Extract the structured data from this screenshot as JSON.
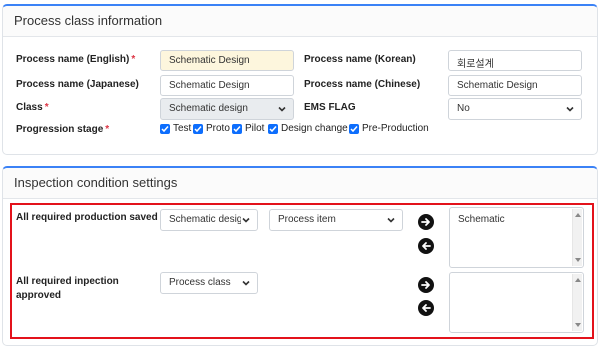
{
  "process_class": {
    "title": "Process class information",
    "labels": {
      "name_en": "Process name (English)",
      "name_ko": "Process name (Korean)",
      "name_ja": "Process name (Japanese)",
      "name_zh": "Process name (Chinese)",
      "class": "Class",
      "ems_flag": "EMS FLAG",
      "stage": "Progression stage",
      "required_mark": "*"
    },
    "values": {
      "name_en": "Schematic Design",
      "name_ko": "회로설계",
      "name_ja": "Schematic Design",
      "name_zh": "Schematic Design",
      "class": "Schematic design",
      "ems_flag": "No"
    },
    "stages": [
      "Test",
      "Proto",
      "Pilot",
      "Design change",
      "Pre-Production"
    ]
  },
  "inspection": {
    "title": "Inspection condition settings",
    "row1": {
      "label": "All required production saved",
      "select1": "Schematic design",
      "select2": "Process item",
      "list_items": [
        "Schematic"
      ]
    },
    "row2": {
      "label_line1": "All required inpection",
      "label_line2": "approved",
      "select1": "Process class",
      "list_items": []
    }
  },
  "colors": {
    "accent": "#3b82f6",
    "required": "#dc3545",
    "highlight_frame": "#e3121b",
    "checkbox": "#0d6efd",
    "highlight_input": "#fdf6dd"
  },
  "icons": {
    "move_right": "arrow-right-circle-icon",
    "move_left": "arrow-left-circle-icon",
    "dropdown": "chevron-down-icon",
    "check": "check-icon"
  }
}
